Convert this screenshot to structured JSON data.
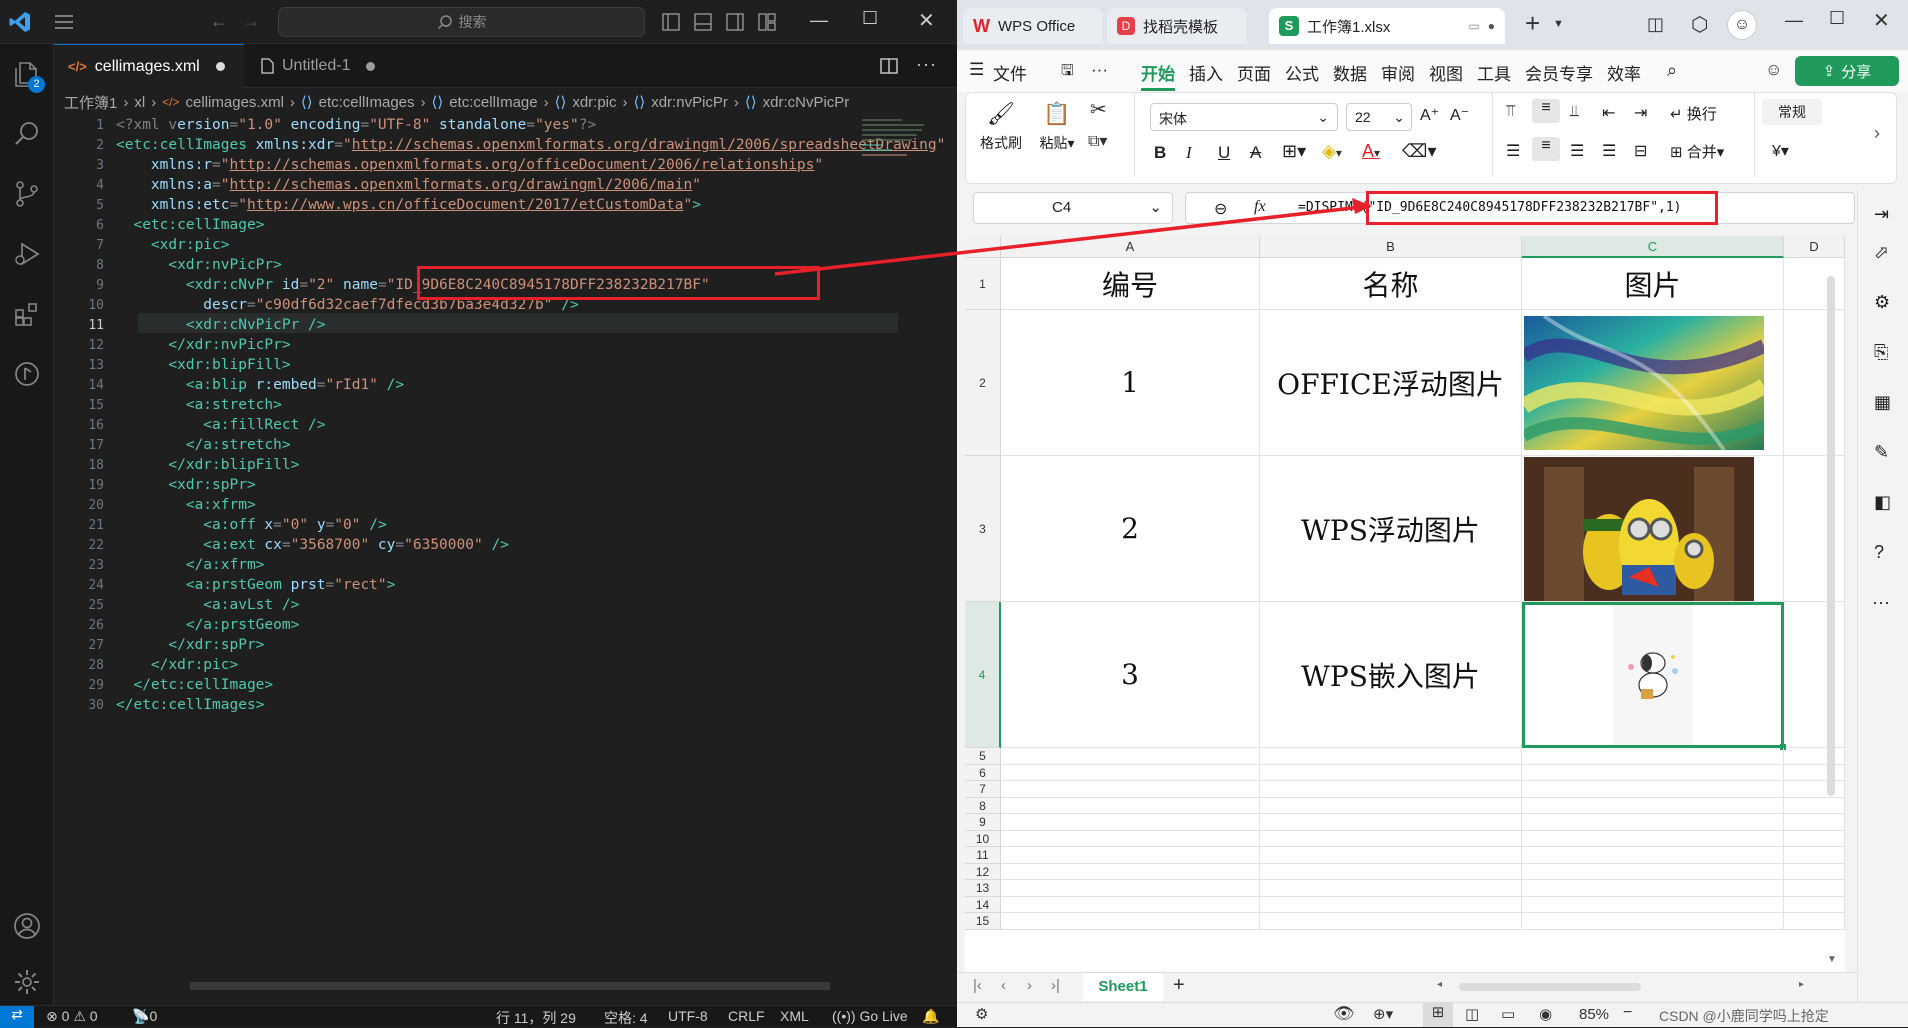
{
  "vscode": {
    "search_placeholder": "搜索",
    "activity_badge": "2",
    "tabs": [
      {
        "label": "cellimages.xml",
        "icon": "</>"
      },
      {
        "label": "Untitled-1"
      }
    ],
    "breadcrumb": [
      "工作簿1",
      "xl",
      "cellimages.xml",
      "etc:cellImages",
      "etc:cellImage",
      "xdr:pic",
      "xdr:nvPicPr",
      "xdr:cNvPicPr"
    ],
    "lines": [
      [
        [
          "pu",
          "<?xml v"
        ],
        [
          "at",
          "ersion"
        ],
        [
          "pu",
          "="
        ],
        [
          "st",
          "\"1.0\""
        ],
        [
          "at",
          " encoding"
        ],
        [
          "pu",
          "="
        ],
        [
          "st",
          "\"UTF-8\""
        ],
        [
          "at",
          " standalone"
        ],
        [
          "pu",
          "="
        ],
        [
          "st",
          "\"yes\""
        ],
        [
          "pu",
          "?>"
        ]
      ],
      [
        [
          "tg",
          "<etc:cellImages"
        ],
        [
          "at",
          " xmlns:xdr"
        ],
        [
          "pu",
          "="
        ],
        [
          "st",
          "\""
        ],
        [
          "ur",
          "http://schemas.openxmlformats.org/drawingml/2006/spreadsheetDrawing"
        ],
        [
          "st",
          "\""
        ]
      ],
      [
        [
          "at",
          "    xmlns:r"
        ],
        [
          "pu",
          "="
        ],
        [
          "st",
          "\""
        ],
        [
          "ur",
          "http://schemas.openxmlformats.org/officeDocument/2006/relationships"
        ],
        [
          "st",
          "\""
        ]
      ],
      [
        [
          "at",
          "    xmlns:a"
        ],
        [
          "pu",
          "="
        ],
        [
          "st",
          "\""
        ],
        [
          "ur",
          "http://schemas.openxmlformats.org/drawingml/2006/main"
        ],
        [
          "st",
          "\""
        ]
      ],
      [
        [
          "at",
          "    xmlns:etc"
        ],
        [
          "pu",
          "="
        ],
        [
          "st",
          "\""
        ],
        [
          "ur",
          "http://www.wps.cn/officeDocument/2017/etCustomData"
        ],
        [
          "st",
          "\""
        ],
        [
          "tg",
          ">"
        ]
      ],
      [
        [
          "tg",
          "  <etc:cellImage>"
        ]
      ],
      [
        [
          "tg",
          "    <xdr:pic>"
        ]
      ],
      [
        [
          "tg",
          "      <xdr:nvPicPr>"
        ]
      ],
      [
        [
          "tg",
          "        <xdr:cNvPr"
        ],
        [
          "at",
          " id"
        ],
        [
          "pu",
          "="
        ],
        [
          "st",
          "\"2\""
        ],
        [
          "at",
          " name"
        ],
        [
          "pu",
          "="
        ],
        [
          "st",
          "\"ID_9D6E8C240C8945178DFF238232B217BF\""
        ]
      ],
      [
        [
          "at",
          "          descr"
        ],
        [
          "pu",
          "="
        ],
        [
          "st",
          "\"c90df6d32caef7dfecd3b7ba3e4d327b\""
        ],
        [
          "tg",
          " />"
        ]
      ],
      [
        [
          "tg",
          "        <xdr:cNvPicPr"
        ],
        [
          "tg",
          " />"
        ]
      ],
      [
        [
          "tg",
          "      </xdr:nvPicPr>"
        ]
      ],
      [
        [
          "tg",
          "      <xdr:blipFill>"
        ]
      ],
      [
        [
          "tg",
          "        <a:blip"
        ],
        [
          "at",
          " r:embed"
        ],
        [
          "pu",
          "="
        ],
        [
          "st",
          "\"rId1\""
        ],
        [
          "tg",
          " />"
        ]
      ],
      [
        [
          "tg",
          "        <a:stretch>"
        ]
      ],
      [
        [
          "tg",
          "          <a:fillRect"
        ],
        [
          "tg",
          " />"
        ]
      ],
      [
        [
          "tg",
          "        </a:stretch>"
        ]
      ],
      [
        [
          "tg",
          "      </xdr:blipFill>"
        ]
      ],
      [
        [
          "tg",
          "      <xdr:spPr>"
        ]
      ],
      [
        [
          "tg",
          "        <a:xfrm>"
        ]
      ],
      [
        [
          "tg",
          "          <a:off"
        ],
        [
          "at",
          " x"
        ],
        [
          "pu",
          "="
        ],
        [
          "st",
          "\"0\""
        ],
        [
          "at",
          " y"
        ],
        [
          "pu",
          "="
        ],
        [
          "st",
          "\"0\""
        ],
        [
          "tg",
          " />"
        ]
      ],
      [
        [
          "tg",
          "          <a:ext"
        ],
        [
          "at",
          " cx"
        ],
        [
          "pu",
          "="
        ],
        [
          "st",
          "\"3568700\""
        ],
        [
          "at",
          " cy"
        ],
        [
          "pu",
          "="
        ],
        [
          "st",
          "\"6350000\""
        ],
        [
          "tg",
          " />"
        ]
      ],
      [
        [
          "tg",
          "        </a:xfrm>"
        ]
      ],
      [
        [
          "tg",
          "        <a:prstGeom"
        ],
        [
          "at",
          " prst"
        ],
        [
          "pu",
          "="
        ],
        [
          "st",
          "\"rect\""
        ],
        [
          "tg",
          ">"
        ]
      ],
      [
        [
          "tg",
          "          <a:avLst"
        ],
        [
          "tg",
          " />"
        ]
      ],
      [
        [
          "tg",
          "        </a:prstGeom>"
        ]
      ],
      [
        [
          "tg",
          "      </xdr:spPr>"
        ]
      ],
      [
        [
          "tg",
          "    </xdr:pic>"
        ]
      ],
      [
        [
          "tg",
          "  </etc:cellImage>"
        ]
      ],
      [
        [
          "tg",
          "</etc:cellImages>"
        ]
      ]
    ],
    "status": {
      "errors": "0",
      "warnings": "0",
      "ports": "0",
      "position": "行 11，列 29",
      "spaces": "空格: 4",
      "encoding": "UTF-8",
      "eol": "CRLF",
      "language": "XML",
      "golive": "Go Live"
    }
  },
  "wps": {
    "tabs": [
      {
        "label": "WPS Office"
      },
      {
        "label": "找稻壳模板"
      },
      {
        "label": "工作簿1.xlsx"
      }
    ],
    "menu": [
      "文件",
      "开始",
      "插入",
      "页面",
      "公式",
      "数据",
      "审阅",
      "视图",
      "工具",
      "会员专享",
      "效率"
    ],
    "share_label": "分享",
    "ribbon": {
      "format_painter": "格式刷",
      "paste": "粘贴",
      "font_name": "宋体",
      "font_size": "22",
      "wrap": "换行",
      "merge": "合并",
      "number_format": "常规"
    },
    "cell_ref": "C4",
    "formula": "=DISPIMG(\"ID_9D6E8C240C8945178DFF238232B217BF\",1)",
    "columns": [
      "A",
      "B",
      "C",
      "D"
    ],
    "rows": [
      "1",
      "2",
      "3",
      "4",
      "5",
      "6",
      "7",
      "8",
      "9",
      "10",
      "11",
      "12",
      "13",
      "14",
      "15"
    ],
    "table": {
      "header": [
        "编号",
        "名称",
        "图片"
      ],
      "data": [
        [
          "1",
          "OFFICE浮动图片"
        ],
        [
          "2",
          "WPS浮动图片"
        ],
        [
          "3",
          "WPS嵌入图片"
        ]
      ]
    },
    "sheet_tab": "Sheet1",
    "zoom": "85%",
    "watermark": "CSDN @小鹿同学吗上抢定"
  }
}
